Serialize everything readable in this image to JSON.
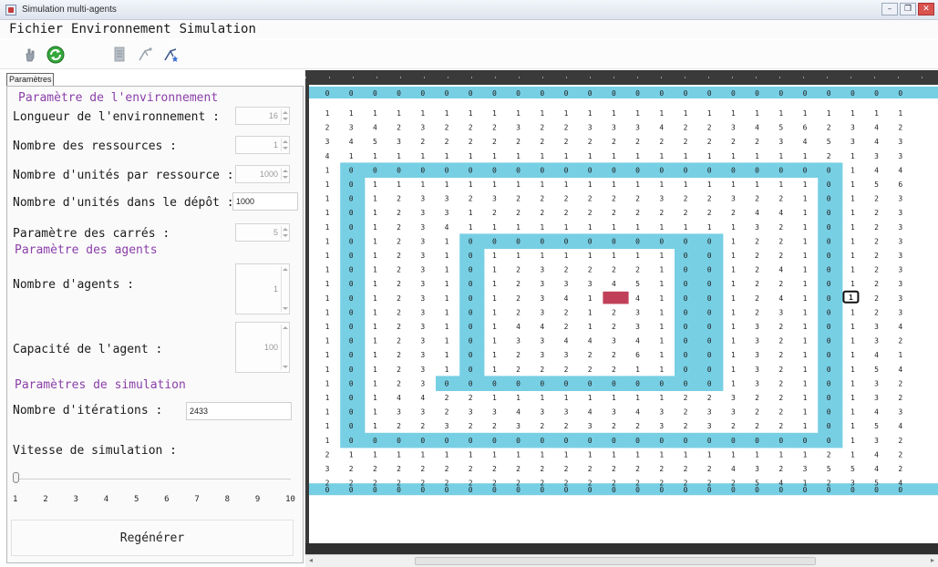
{
  "window": {
    "title": "Simulation multi-agents"
  },
  "menu": [
    "Fichier",
    "Environnement",
    "Simulation"
  ],
  "toolbar": {
    "icons": [
      "hand-icon",
      "refresh-icon",
      "document-icon",
      "antenna-icon",
      "star-icon"
    ]
  },
  "tab": {
    "label": "Paramètres"
  },
  "environment": {
    "section_title": "Paramètre de l'environnement",
    "length_label": "Longueur de l'environnement :",
    "length_value": "16",
    "resources_label": "Nombre des ressources :",
    "resources_value": "1",
    "units_per_resource_label": "Nombre d'unités par ressource :",
    "units_per_resource_value": "1000",
    "units_depot_label": "Nombre d'unités dans le dépôt :",
    "units_depot_value": "1000",
    "squares_label": "Paramètre des carrés :",
    "squares_value": "5"
  },
  "agents": {
    "section_title": "Paramètre des agents",
    "count_label": "Nombre d'agents :",
    "count_value": "1",
    "capacity_label": "Capacité de l'agent :",
    "capacity_value": "100"
  },
  "simulation": {
    "section_title": "Paramètres de simulation",
    "iterations_label": "Nombre d'itérations :",
    "iterations_value": "2433",
    "speed_label": "Vitesse de simulation :",
    "speed_value": 1,
    "speed_ticks": [
      "1",
      "2",
      "3",
      "4",
      "5",
      "6",
      "7",
      "8",
      "9",
      "10"
    ],
    "regen_label": "Regénérer"
  },
  "grid": {
    "cols": 25,
    "rows": 27,
    "cell_value": "1",
    "ring_value": "0",
    "ring_color": "#77cfe4",
    "resource_color": "#c0405a",
    "agent_label": "1",
    "rows_data": [
      "1111111111111111111111111",
      "2342322232233342234562342",
      "3453222222222222222345343",
      "4111111111111111111112133",
      "1000000000000000000000144",
      "1011111111111111111110156",
      "1012332322222232232210123",
      "1012331222222222224410123",
      "1012341111111111113210123",
      "1012310000000000012210123",
      "1012310111111110012210123",
      "1012310123222210012410123",
      "1012310123334510012210123",
      "1012310123413410012410123",
      "1012310123212310012310123",
      "1012310144212310013210134",
      "1012310133443410013210132",
      "1012310123322610013210141",
      "1012310122222110013210154",
      "1012300000000000013210132",
      "1014422111111112232210132",
      "1013323343343432332210143",
      "1012232232232232322210154",
      "1000000000000000000000132",
      "2111111111111111111112142",
      "3222222222222222243235542",
      "2222222222222222225412354"
    ]
  }
}
